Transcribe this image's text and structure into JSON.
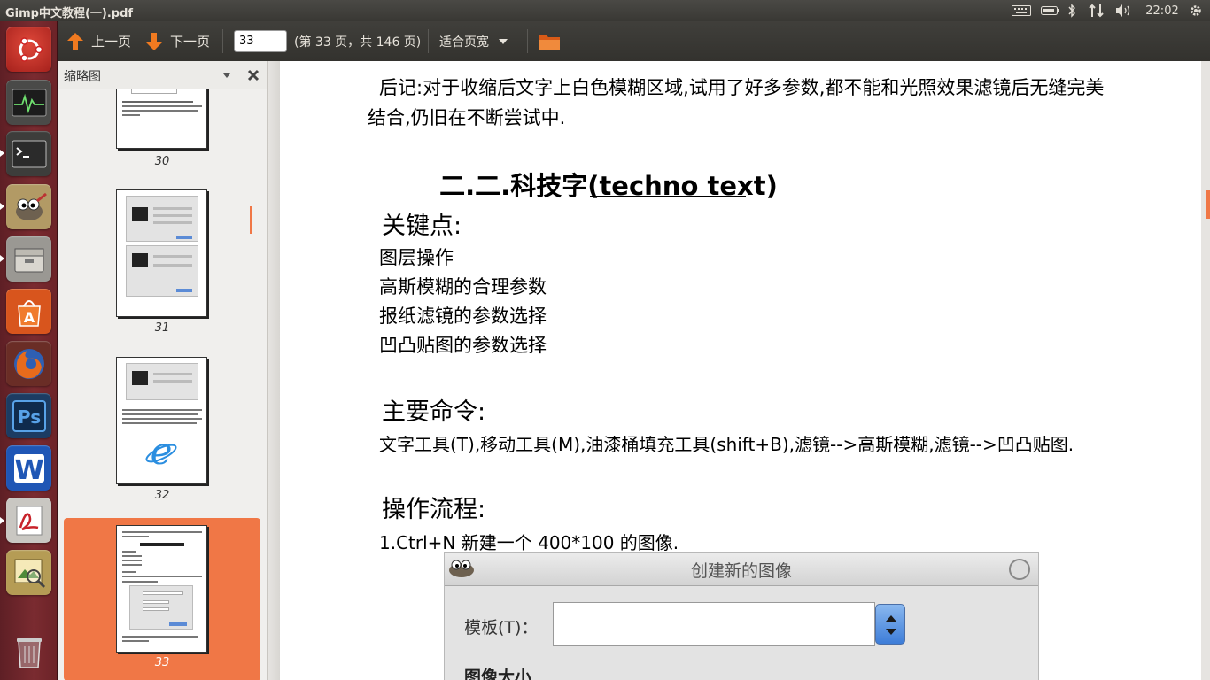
{
  "window": {
    "title": "Gimp中文教程(一).pdf"
  },
  "tray": {
    "time": "22:02",
    "icons": [
      "keyboard-icon",
      "battery-icon",
      "bluetooth-icon",
      "network-icon",
      "volume-icon",
      "settings-gear-icon"
    ]
  },
  "launcher": {
    "items": [
      "ubuntu-dash-icon",
      "system-monitor-icon",
      "terminal-icon",
      "gimp-icon",
      "file-manager-icon",
      "software-center-icon",
      "firefox-icon",
      "photoshop-icon",
      "wps-writer-icon",
      "pdf-viewer-icon",
      "image-viewer-icon",
      "trash-icon"
    ]
  },
  "toolbar": {
    "prev_label": "上一页",
    "next_label": "下一页",
    "page_value": "33",
    "page_info": "(第 33 页，共 146 页)",
    "zoom_label": "适合页宽"
  },
  "sidebar": {
    "title": "缩略图",
    "thumbnails": [
      {
        "page": "30"
      },
      {
        "page": "31"
      },
      {
        "page": "32"
      },
      {
        "page": "33",
        "selected": true
      }
    ]
  },
  "document": {
    "intro_line1": "后记:对于收缩后文字上白色模糊区域,试用了好多参数,都不能和光照效果滤镜后无缝完美",
    "intro_line2": "结合,仍旧在不断尝试中.",
    "heading": "二.二.科技字(techno text)",
    "key_points_title": "关键点:",
    "key_points": [
      "图层操作",
      "高斯模糊的合理参数",
      "报纸滤镜的参数选择",
      "凹凸贴图的参数选择"
    ],
    "commands_title": "主要命令:",
    "commands_text": "文字工具(T),移动工具(M),油漆桶填充工具(shift+B),滤镜-->高斯模糊,滤镜-->凹凸贴图.",
    "process_title": "操作流程:",
    "step1": "1.Ctrl+N 新建一个 400*100 的图像.",
    "dialog": {
      "title": "创建新的图像",
      "template_label": "模板(T)：",
      "size_label": "图像大小"
    }
  },
  "colors": {
    "accent": "#f07746",
    "launcher": "#6d2328",
    "panel": "#3c3b37"
  }
}
